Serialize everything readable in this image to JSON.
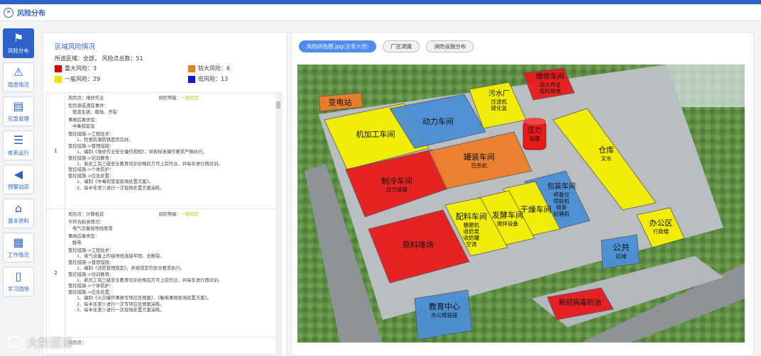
{
  "header": {
    "title": "风险分布"
  },
  "sidebar": {
    "items": [
      {
        "label": "风险分布",
        "icon": "flag-icon",
        "active": true
      },
      {
        "label": "隐患情况",
        "icon": "warning-icon",
        "active": false
      },
      {
        "label": "应急管理",
        "icon": "emergency-doc-icon",
        "active": false
      },
      {
        "label": "体系运行",
        "icon": "layers-icon",
        "active": false
      },
      {
        "label": "预警动态",
        "icon": "megaphone-icon",
        "active": false
      },
      {
        "label": "基本资料",
        "icon": "home-icon",
        "active": false
      },
      {
        "label": "工作情况",
        "icon": "calendar-icon",
        "active": false
      },
      {
        "label": "学习园地",
        "icon": "book-icon",
        "active": false
      }
    ]
  },
  "panel": {
    "title": "区域风险情况",
    "summary": "所选区域：全部，  风险点总数：51",
    "legend": [
      {
        "label": "重大风险：3",
        "color": "#e00000"
      },
      {
        "label": "较大风险：6",
        "color": "#ef7c22"
      },
      {
        "label": "一般风险：29",
        "color": "#f2e500"
      },
      {
        "label": "低风险：13",
        "color": "#1414d0"
      }
    ]
  },
  "risks": [
    {
      "num": "1",
      "point": "风险点：维修作业",
      "level_label": "风险等级：",
      "level": "一般风险",
      "lines": [
        {
          "t": "危险源或潜在事件：",
          "i": 0
        },
        {
          "t": "管道生锈、腐蚀、开裂",
          "i": 1
        },
        {
          "t": "事故后果类型：",
          "i": 0
        },
        {
          "t": "中毒和窒息",
          "i": 1
        },
        {
          "t": "管控措施->工程技术：",
          "i": 0
        },
        {
          "t": "1、检查防潮防锈是否完好。",
          "i": 2
        },
        {
          "t": "管控措施->管理措施：",
          "i": 0
        },
        {
          "t": "1、编制《维修作业安全操作规程》，并按标准操作要求严格执行。",
          "i": 2
        },
        {
          "t": "管控措施->培训教育：",
          "i": 0
        },
        {
          "t": "1、新员工岗三级安全教育培训合格后方可上岗作业，并每年进行再培训。",
          "i": 2
        },
        {
          "t": "管控措施->个体防护：",
          "i": 0
        },
        {
          "t": "管控措施->应急处置：",
          "i": 0
        },
        {
          "t": "1、编制《中毒和窒息现场处置方案》。",
          "i": 2
        },
        {
          "t": "2、每半年至少进行一次现场处置方案演练。",
          "i": 2
        }
      ]
    },
    {
      "num": "2",
      "point": "风险点：计算机房",
      "level_label": "风险等级：",
      "level": "一般风险",
      "lines": [
        {
          "t": "不符合标准情况：",
          "i": 0
        },
        {
          "t": "电气设备接地线脱落",
          "i": 1
        },
        {
          "t": "事故后果类型：",
          "i": 0
        },
        {
          "t": "触电",
          "i": 1
        },
        {
          "t": "管控措施->工程技术：",
          "i": 0
        },
        {
          "t": "1、电气设备上的接地线连接牢固、无断裂。",
          "i": 2
        },
        {
          "t": "管控措施->管理措施：",
          "i": 0
        },
        {
          "t": "1、编制《消防管理规定》，并按规定的安全要求执行。",
          "i": 2
        },
        {
          "t": "管控措施->培训教育：",
          "i": 0
        },
        {
          "t": "1、新员工岗三级安全教育培训合格后方可上岗作业，并每年进行再培训。",
          "i": 2
        },
        {
          "t": "管控措施->个体防护：",
          "i": 0
        },
        {
          "t": "管控措施->应急处置：",
          "i": 0
        },
        {
          "t": "1、编制《火灾爆炸事故专项应急预案》、《触电事故现场处置方案》。",
          "i": 2
        },
        {
          "t": "2、每半年至少进行一次专项应急预案演练。",
          "i": 2
        },
        {
          "t": "3、每半年至少进行一次现场处置方案演练。",
          "i": 2
        }
      ]
    },
    {
      "num": "",
      "point": "风险点：",
      "level_label": "",
      "level": "",
      "lines": []
    }
  ],
  "tabs": [
    {
      "label": "风险四色图.jpg",
      "sub": "(查看大图)",
      "active": true
    },
    {
      "label": "厂区调度",
      "sub": "",
      "active": false
    },
    {
      "label": "消防设施分布",
      "sub": "",
      "active": false
    }
  ],
  "map": {
    "zones": [
      {
        "id": "substation",
        "label": "变电站",
        "sub": "",
        "color": "orange"
      },
      {
        "id": "machining",
        "label": "机加工车间",
        "sub": "",
        "color": "yellow"
      },
      {
        "id": "power",
        "label": "动力车间",
        "sub": "",
        "color": "blue"
      },
      {
        "id": "sewage",
        "label": "污水厂",
        "sub": "压滤机\n硫化氢",
        "color": "yellow"
      },
      {
        "id": "maintenance",
        "label": "维修车间",
        "sub": "动火作业\n临时用电",
        "color": "red"
      },
      {
        "id": "pressure",
        "label": "压力",
        "sub": "容器",
        "color": "red"
      },
      {
        "id": "refrigeration",
        "label": "制冷车间",
        "sub": "压力容器",
        "color": "red"
      },
      {
        "id": "canning",
        "label": "罐装车间",
        "sub": "巴杀机",
        "color": "orange"
      },
      {
        "id": "warehouse",
        "label": "仓库",
        "sub": "叉车",
        "color": "yellow"
      },
      {
        "id": "packaging",
        "label": "包装车间",
        "sub": "称重仪\n喷胶机\n链条\n封箱机",
        "color": "blue"
      },
      {
        "id": "drying",
        "label": "干燥车间",
        "sub": "",
        "color": "yellow"
      },
      {
        "id": "fermentation",
        "label": "发酵车间",
        "sub": "搅拌设备",
        "color": "yellow"
      },
      {
        "id": "batching",
        "label": "配料车间",
        "sub": "糖磨机\n收奶泵\n收奶罐\n空调",
        "color": "yellow"
      },
      {
        "id": "yard",
        "label": "原料堆场",
        "sub": "",
        "color": "red"
      },
      {
        "id": "office",
        "label": "办公区",
        "sub": "行政楼",
        "color": "yellow"
      },
      {
        "id": "public",
        "label": "公共",
        "sub": "区域",
        "color": "blue"
      },
      {
        "id": "education",
        "label": "教育中心",
        "sub": "办公楼插座",
        "color": "blue"
      },
      {
        "id": "fire",
        "label": "新冠病毒防治",
        "sub": "",
        "color": "red"
      }
    ]
  },
  "watermark": "大数据道"
}
